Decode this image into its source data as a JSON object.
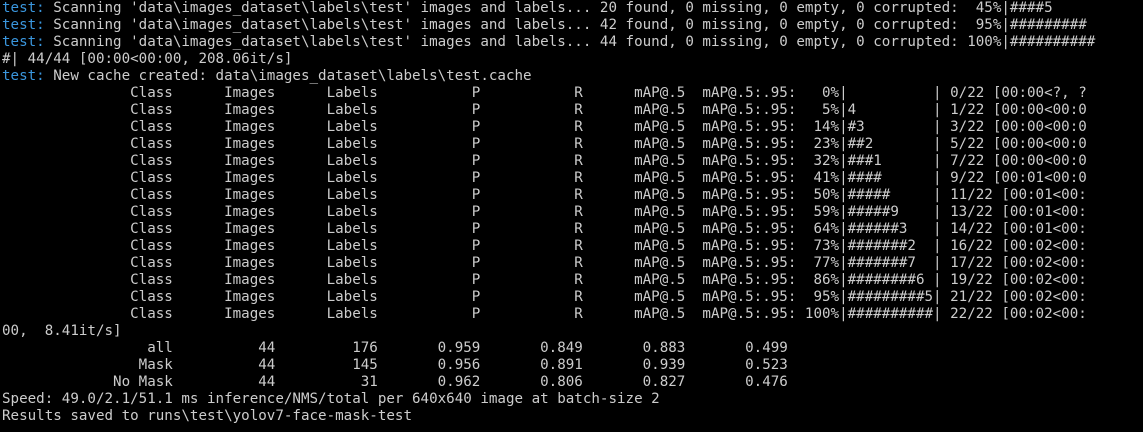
{
  "terminal": {
    "colors": {
      "background": "#000000",
      "text": "#cccccc",
      "prefix": "#3a96dd"
    },
    "lines": [
      {
        "prefix": "test:",
        "text": " Scanning 'data\\images_dataset\\labels\\test' images and labels... 20 found, 0 missing, 0 empty, 0 corrupted:  45%|####5"
      },
      {
        "prefix": "test:",
        "text": " Scanning 'data\\images_dataset\\labels\\test' images and labels... 42 found, 0 missing, 0 empty, 0 corrupted:  95%|#########"
      },
      {
        "prefix": "test:",
        "text": " Scanning 'data\\images_dataset\\labels\\test' images and labels... 44 found, 0 missing, 0 empty, 0 corrupted: 100%|##########"
      },
      {
        "prefix": "",
        "text": "#| 44/44 [00:00<00:00, 208.06it/s]"
      },
      {
        "prefix": "test:",
        "text": " New cache created: data\\images_dataset\\labels\\test.cache"
      },
      {
        "prefix": "",
        "text": "               Class      Images      Labels           P           R      mAP@.5  mAP@.5:.95:   0%|          | 0/22 [00:00<?, ?"
      },
      {
        "prefix": "",
        "text": "               Class      Images      Labels           P           R      mAP@.5  mAP@.5:.95:   5%|4         | 1/22 [00:00<00:0"
      },
      {
        "prefix": "",
        "text": "               Class      Images      Labels           P           R      mAP@.5  mAP@.5:.95:  14%|#3        | 3/22 [00:00<00:0"
      },
      {
        "prefix": "",
        "text": "               Class      Images      Labels           P           R      mAP@.5  mAP@.5:.95:  23%|##2       | 5/22 [00:00<00:0"
      },
      {
        "prefix": "",
        "text": "               Class      Images      Labels           P           R      mAP@.5  mAP@.5:.95:  32%|###1      | 7/22 [00:00<00:0"
      },
      {
        "prefix": "",
        "text": "               Class      Images      Labels           P           R      mAP@.5  mAP@.5:.95:  41%|####      | 9/22 [00:01<00:0"
      },
      {
        "prefix": "",
        "text": "               Class      Images      Labels           P           R      mAP@.5  mAP@.5:.95:  50%|#####     | 11/22 [00:01<00:"
      },
      {
        "prefix": "",
        "text": "               Class      Images      Labels           P           R      mAP@.5  mAP@.5:.95:  59%|#####9    | 13/22 [00:01<00:"
      },
      {
        "prefix": "",
        "text": "               Class      Images      Labels           P           R      mAP@.5  mAP@.5:.95:  64%|######3   | 14/22 [00:01<00:"
      },
      {
        "prefix": "",
        "text": "               Class      Images      Labels           P           R      mAP@.5  mAP@.5:.95:  73%|#######2  | 16/22 [00:02<00:"
      },
      {
        "prefix": "",
        "text": "               Class      Images      Labels           P           R      mAP@.5  mAP@.5:.95:  77%|#######7  | 17/22 [00:02<00:"
      },
      {
        "prefix": "",
        "text": "               Class      Images      Labels           P           R      mAP@.5  mAP@.5:.95:  86%|########6 | 19/22 [00:02<00:"
      },
      {
        "prefix": "",
        "text": "               Class      Images      Labels           P           R      mAP@.5  mAP@.5:.95:  95%|#########5| 21/22 [00:02<00:"
      },
      {
        "prefix": "",
        "text": "               Class      Images      Labels           P           R      mAP@.5  mAP@.5:.95: 100%|##########| 22/22 [00:02<00:"
      },
      {
        "prefix": "",
        "text": "00,  8.41it/s]"
      },
      {
        "prefix": "",
        "text": "                 all          44         176       0.959       0.849       0.883       0.499"
      },
      {
        "prefix": "",
        "text": "                Mask          44         145       0.956       0.891       0.939       0.523"
      },
      {
        "prefix": "",
        "text": "             No Mask          44          31       0.962       0.806       0.827       0.476"
      },
      {
        "prefix": "",
        "text": "Speed: 49.0/2.1/51.1 ms inference/NMS/total per 640x640 image at batch-size 2"
      },
      {
        "prefix": "",
        "text": "Results saved to runs\\test\\yolov7-face-mask-test"
      }
    ]
  }
}
